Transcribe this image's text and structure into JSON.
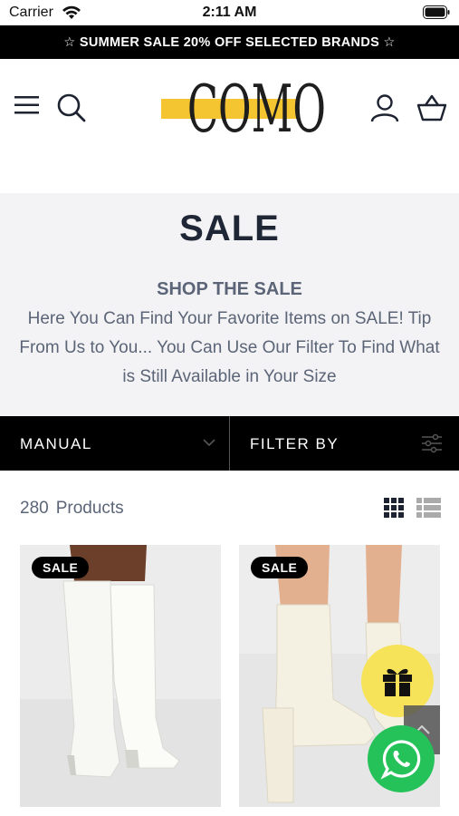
{
  "status_bar": {
    "carrier": "Carrier",
    "time": "2:11 AM"
  },
  "promo": {
    "text": "☆ SUMMER SALE 20% OFF SELECTED BRANDS ☆"
  },
  "header": {
    "logo_text": "COMO",
    "logo_accent": "#f4c531"
  },
  "icons": {
    "menu": "hamburger-menu-icon",
    "search": "search-icon",
    "account": "account-icon",
    "cart": "basket-icon",
    "grid_view": "grid-view-icon",
    "list_view": "list-view-icon",
    "gift": "gift-icon",
    "whatsapp": "whatsapp-icon",
    "back_to_top": "chevron-up-icon"
  },
  "hero": {
    "title": "SALE",
    "subtitle": "SHOP THE SALE",
    "description": "Here You Can Find Your Favorite Items on SALE! Tip From Us to You... You Can Use Our Filter To Find What is Still Available in Your Size"
  },
  "toolbar": {
    "sort_label": "MANUAL",
    "filter_label": "FILTER BY"
  },
  "products_summary": {
    "count": "280",
    "label": "Products"
  },
  "products": [
    {
      "badge": "SALE",
      "image": "white knee-high boots"
    },
    {
      "badge": "SALE",
      "image": "cream platform ankle boots"
    }
  ],
  "colors": {
    "promo_bg": "#000000",
    "hero_bg": "#f3f3f5",
    "gift_bg": "#f6e35a",
    "whatsapp_bg": "#25c25a",
    "text_muted": "#5b6577"
  }
}
